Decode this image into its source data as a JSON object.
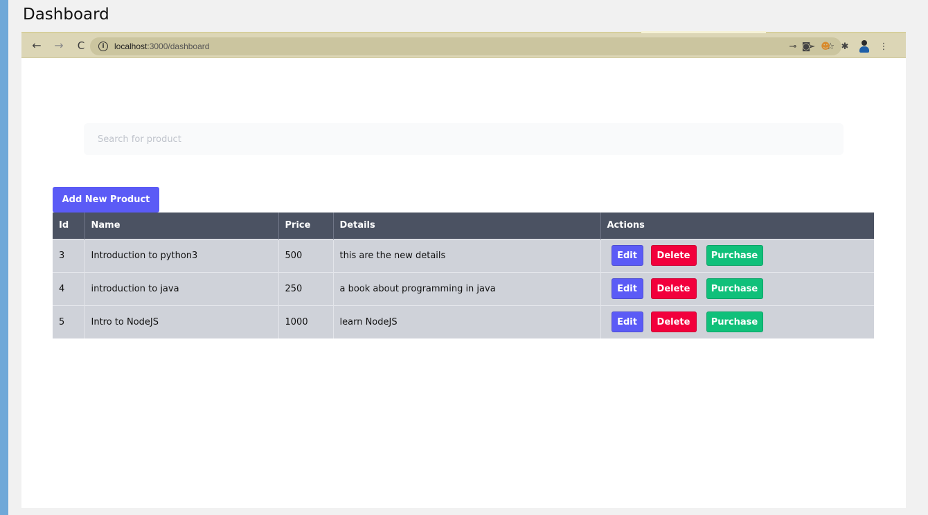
{
  "page_title": "Dashboard",
  "browser": {
    "url_host": "localhost",
    "url_rest": ":3000/dashboard"
  },
  "search": {
    "placeholder": "Search for product",
    "value": ""
  },
  "add_button_label": "Add New Product",
  "table": {
    "headers": [
      "Id",
      "Name",
      "Price",
      "Details",
      "Actions"
    ],
    "rows": [
      {
        "id": "3",
        "name": "Introduction to python3",
        "price": "500",
        "details": "this are the new details"
      },
      {
        "id": "4",
        "name": "introduction to java",
        "price": "250",
        "details": "a book about programming in java"
      },
      {
        "id": "5",
        "name": "Intro to NodeJS",
        "price": "1000",
        "details": "learn NodeJS"
      }
    ],
    "action_labels": {
      "edit": "Edit",
      "delete": "Delete",
      "purchase": "Purchase"
    }
  },
  "colors": {
    "primary": "#5b5bf6",
    "danger": "#f2003c",
    "success": "#10c07a",
    "table_header": "#4b5262",
    "row_bg": "#cfd2d9"
  }
}
